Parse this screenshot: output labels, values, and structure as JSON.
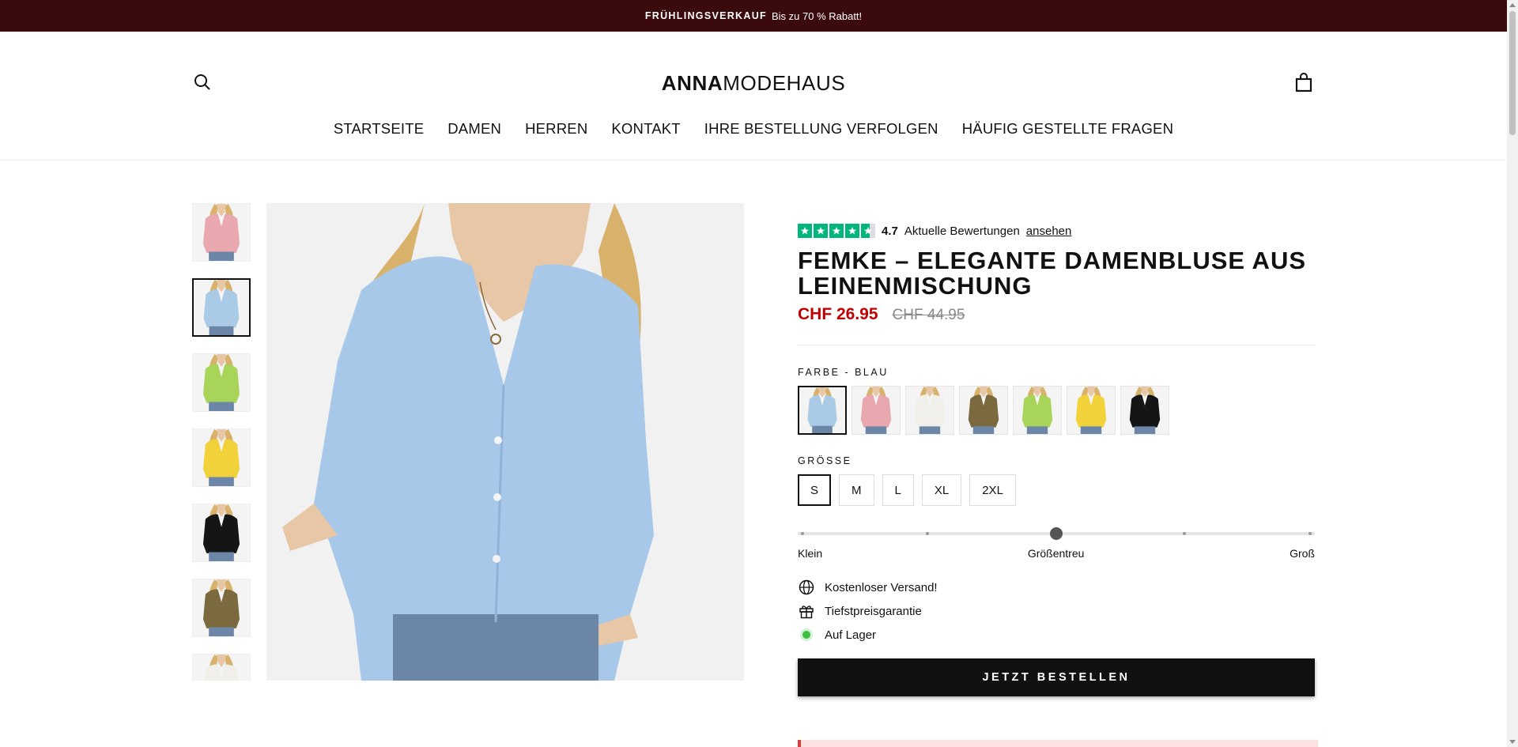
{
  "announcement": {
    "bold": "FRÜHLINGSVERKAUF",
    "text": "Bis zu 70 % Rabatt!"
  },
  "header": {
    "logo_bold": "ANNA",
    "logo_rest": "MODEHAUS",
    "search_icon": "search-icon",
    "cart_icon": "shopping-bag-icon"
  },
  "nav": [
    {
      "label": "STARTSEITE"
    },
    {
      "label": "DAMEN"
    },
    {
      "label": "HERREN"
    },
    {
      "label": "KONTAKT"
    },
    {
      "label": "IHRE BESTELLUNG VERFOLGEN"
    },
    {
      "label": "HÄUFIG GESTELLTE FRAGEN"
    }
  ],
  "gallery": {
    "thumbnails": [
      {
        "color": "#e9a7b0",
        "name": "Rosa"
      },
      {
        "color": "#a9cbe6",
        "name": "Blau",
        "active": true
      },
      {
        "color": "#a8d45a",
        "name": "Grün"
      },
      {
        "color": "#f2d23a",
        "name": "Gelb"
      },
      {
        "color": "#151515",
        "name": "Schwarz"
      },
      {
        "color": "#7a6a3e",
        "name": "Khaki"
      },
      {
        "color": "#f0efe9",
        "name": "Weiß"
      }
    ],
    "main_color": "#a7c8e8"
  },
  "product": {
    "rating_score": "4.7",
    "rating_text": "Aktuelle Bewertungen",
    "rating_link": "ansehen",
    "title": "FEMKE – ELEGANTE DAMENBLUSE AUS LEINENMISCHUNG",
    "price_sale": "CHF 26.95",
    "price_old": "CHF 44.95",
    "color_label": "FARBE - BLAU",
    "swatches": [
      {
        "color": "#a9cbe6",
        "active": true
      },
      {
        "color": "#e9a7b0"
      },
      {
        "color": "#f0efe9"
      },
      {
        "color": "#7a6a3e"
      },
      {
        "color": "#a8d45a"
      },
      {
        "color": "#f2d23a"
      },
      {
        "color": "#151515"
      }
    ],
    "size_label": "GRÖSSE",
    "sizes": [
      {
        "label": "S",
        "active": true
      },
      {
        "label": "M"
      },
      {
        "label": "L"
      },
      {
        "label": "XL"
      },
      {
        "label": "2XL"
      }
    ],
    "fit": {
      "left": "Klein",
      "center": "Größentreu",
      "right": "Groß",
      "value": 0.5
    },
    "features": [
      {
        "icon": "globe-icon",
        "text": "Kostenloser Versand!"
      },
      {
        "icon": "gift-icon",
        "text": "Tiefstpreisgarantie"
      },
      {
        "icon": "stock-dot-icon",
        "text": "Auf Lager"
      }
    ],
    "order_button": "JETZT BESTELLEN"
  },
  "colors": {
    "accent_price": "#c00000",
    "announce_bg": "#3a0a0c",
    "trustpilot_green": "#00b67a"
  }
}
